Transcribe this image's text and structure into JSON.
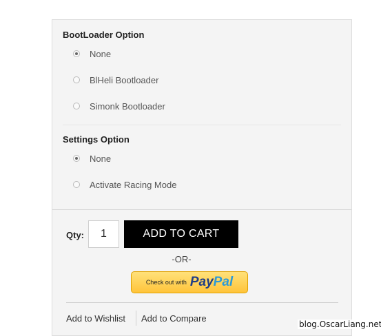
{
  "bootloader": {
    "title": "BootLoader Option",
    "options": [
      {
        "label": "None",
        "selected": true
      },
      {
        "label": "BlHeli Bootloader",
        "selected": false
      },
      {
        "label": "Simonk Bootloader",
        "selected": false
      }
    ]
  },
  "settings": {
    "title": "Settings Option",
    "options": [
      {
        "label": "None",
        "selected": true
      },
      {
        "label": "Activate Racing Mode",
        "selected": false
      }
    ]
  },
  "purchase": {
    "qty_label": "Qty:",
    "qty_value": "1",
    "add_to_cart": "ADD TO CART",
    "or_text": "-OR-",
    "paypal_checkout": "Check out with",
    "paypal_pay": "Pay",
    "paypal_pal": "Pal"
  },
  "links": {
    "wishlist": "Add to Wishlist",
    "compare": "Add to Compare"
  },
  "watermark": "blog.OscarLiang.net"
}
